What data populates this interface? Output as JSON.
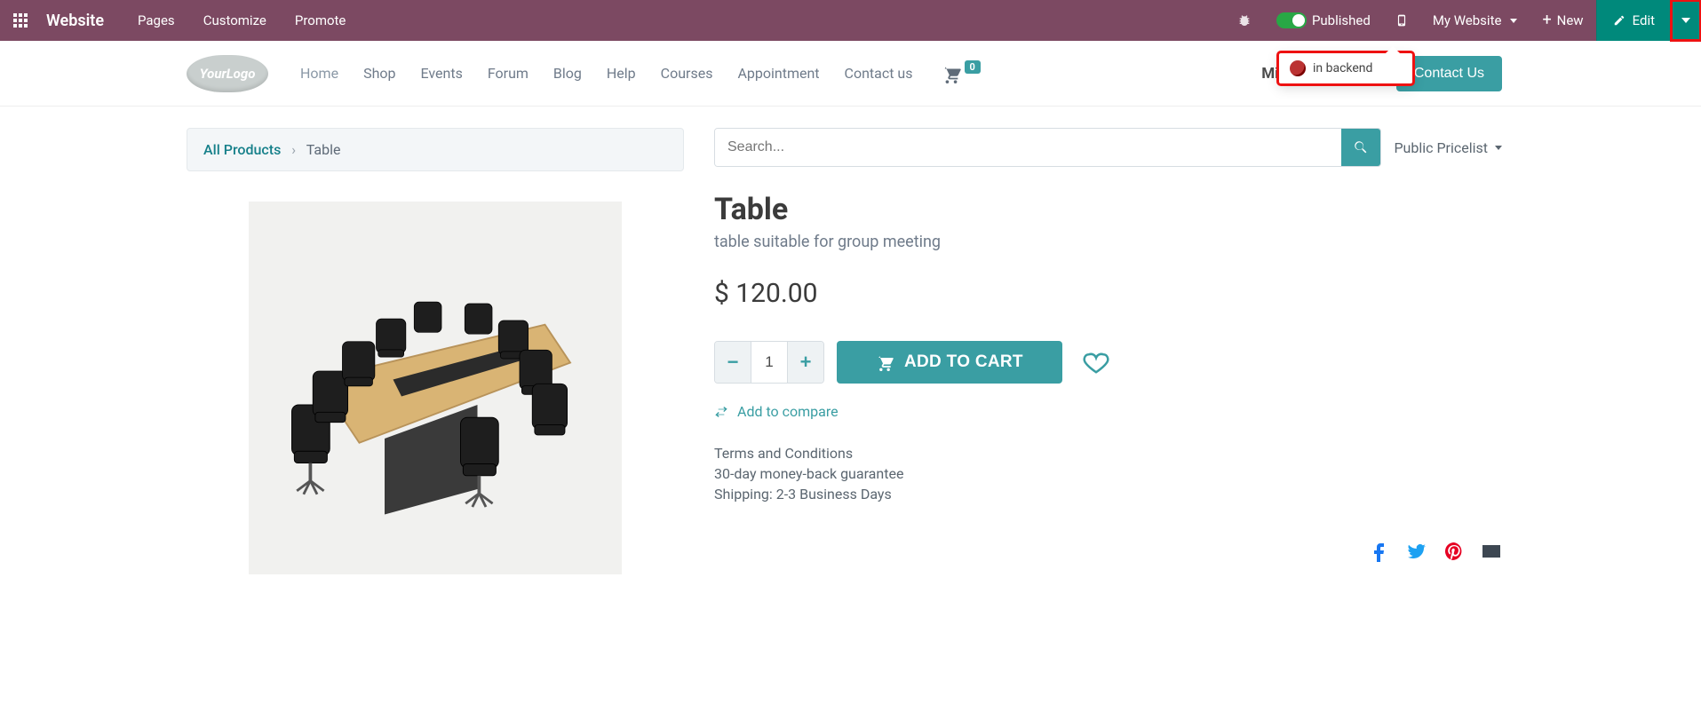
{
  "admin": {
    "brand": "Website",
    "links": [
      "Pages",
      "Customize",
      "Promote"
    ],
    "published": "Published",
    "my_site": "My Website",
    "new": "New",
    "edit": "Edit",
    "dropdown_item": "in backend"
  },
  "header": {
    "logo_text": "YourLogo",
    "nav": [
      "Home",
      "Shop",
      "Events",
      "Forum",
      "Blog",
      "Help",
      "Courses",
      "Appointment",
      "Contact us"
    ],
    "cart_count": "0",
    "user": "Mitchell Admin",
    "contact": "Contact Us"
  },
  "breadcrumb": {
    "root": "All Products",
    "current": "Table"
  },
  "search": {
    "placeholder": "Search...",
    "pricelist": "Public Pricelist"
  },
  "product": {
    "title": "Table",
    "subtitle": "table suitable for group meeting",
    "price": "$ 120.00",
    "qty": "1",
    "add_to_cart": "ADD TO CART",
    "compare": "Add to compare",
    "terms_heading": "Terms and Conditions",
    "terms_l1": "30-day money-back guarantee",
    "terms_l2": "Shipping: 2-3 Business Days"
  }
}
